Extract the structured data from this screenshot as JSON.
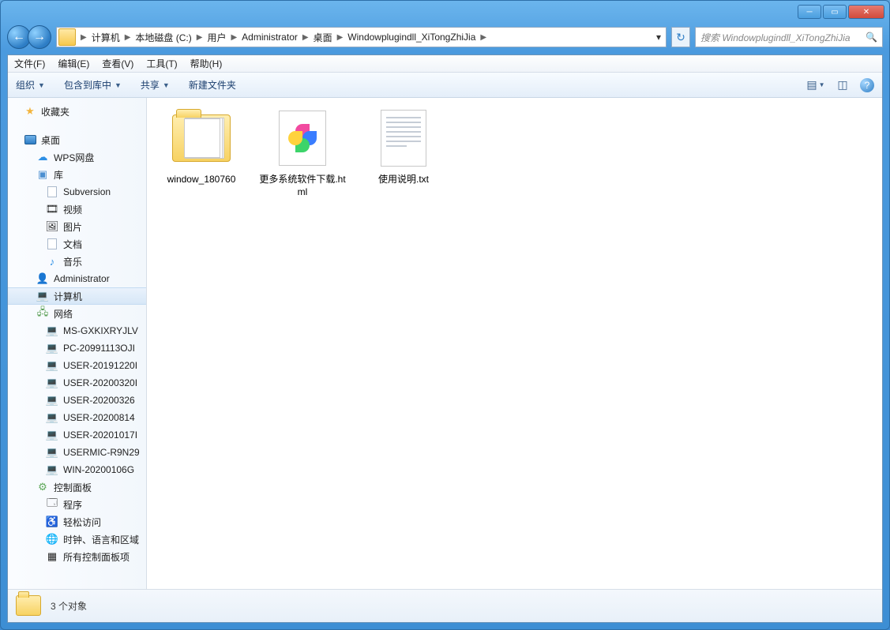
{
  "breadcrumb": {
    "items": [
      "计算机",
      "本地磁盘 (C:)",
      "用户",
      "Administrator",
      "桌面",
      "Windowplugindll_XiTongZhiJia"
    ]
  },
  "search": {
    "placeholder": "搜索 Windowplugindll_XiTongZhiJia"
  },
  "menu": {
    "file": "文件(F)",
    "edit": "编辑(E)",
    "view": "查看(V)",
    "tools": "工具(T)",
    "help": "帮助(H)"
  },
  "toolbar": {
    "organize": "组织",
    "include": "包含到库中",
    "share": "共享",
    "newfolder": "新建文件夹"
  },
  "sidebar": {
    "favorites": "收藏夹",
    "desktop": "桌面",
    "wps": "WPS网盘",
    "libraries": "库",
    "lib_items": {
      "subversion": "Subversion",
      "video": "视频",
      "pictures": "图片",
      "documents": "文档",
      "music": "音乐"
    },
    "admin": "Administrator",
    "computer": "计算机",
    "network": "网络",
    "net_items": [
      "MS-GXKIXRYJLV",
      "PC-20991113OJI",
      "USER-20191220I",
      "USER-20200320I",
      "USER-20200326",
      "USER-20200814",
      "USER-20201017I",
      "USERMIC-R9N29",
      "WIN-20200106G"
    ],
    "control_panel": "控制面板",
    "cp_items": {
      "programs": "程序",
      "ease": "轻松访问",
      "region": "时钟、语言和区域",
      "truncated": "所有控制面板项"
    }
  },
  "files": {
    "f0": "window_180760",
    "f1": "更多系统软件下载.html",
    "f2": "使用说明.txt"
  },
  "status": {
    "text": "3 个对象"
  }
}
